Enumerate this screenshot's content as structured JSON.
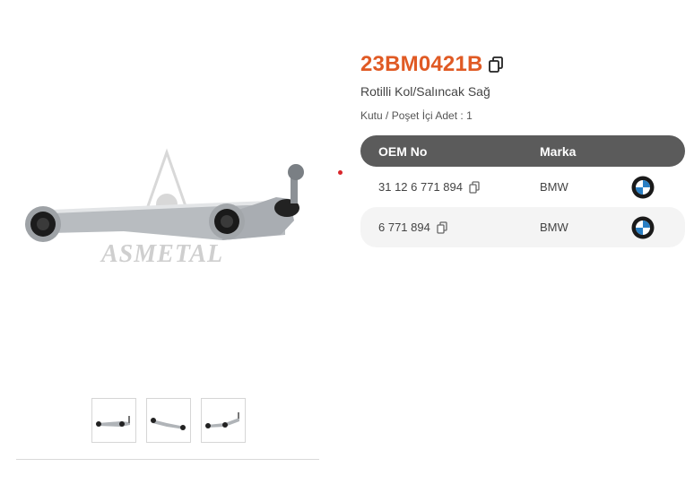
{
  "product": {
    "code": "23BM0421B",
    "name": "Rotilli Kol/Salıncak Sağ",
    "package": "Kutu / Poşet İçi Adet : 1",
    "watermark": "ASMETAL"
  },
  "oem_table": {
    "headers": {
      "oem": "OEM No",
      "brand": "Marka"
    },
    "rows": [
      {
        "oem": "31 12 6 771 894",
        "brand": "BMW",
        "logo": "bmw-logo-icon"
      },
      {
        "oem": "6 771 894",
        "brand": "BMW",
        "logo": "bmw-logo-icon"
      }
    ]
  },
  "gallery": {
    "thumbnail_count": 3
  },
  "colors": {
    "accent": "#e05a24",
    "header_bg": "#5b5b5b",
    "indicator": "#d9262b"
  }
}
